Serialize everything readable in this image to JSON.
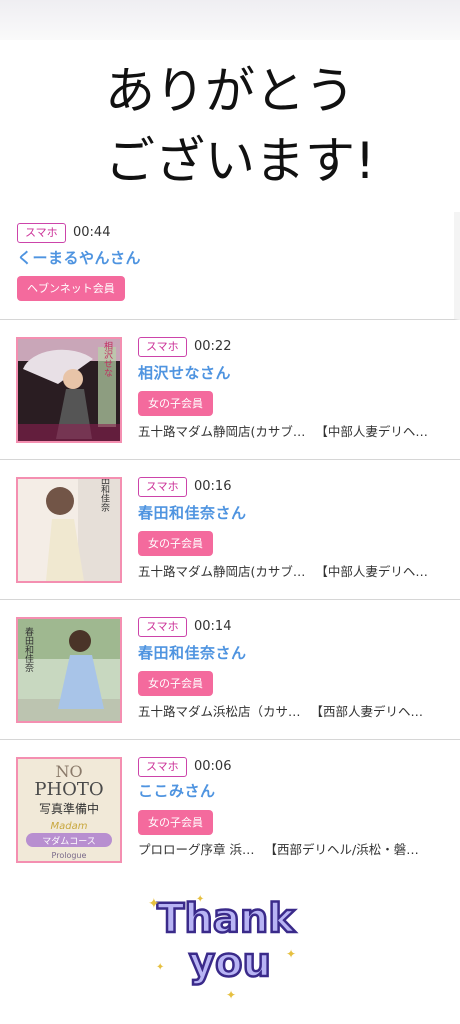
{
  "top_banner": {
    "text_line1": "ありがとう",
    "text_line2": "ございます!"
  },
  "entries": [
    {
      "device": "スマホ",
      "time": "00:44",
      "name": "くーまるやんさん",
      "member": "ヘブンネット会員",
      "shop": "",
      "area": ""
    },
    {
      "device": "スマホ",
      "time": "00:22",
      "name": "相沢せなさん",
      "member": "女の子会員",
      "shop": "五十路マダム静岡店(カサブ…",
      "area": "【中部人妻デリヘ…"
    },
    {
      "device": "スマホ",
      "time": "00:16",
      "name": "春田和佳奈さん",
      "member": "女の子会員",
      "shop": "五十路マダム静岡店(カサブ…",
      "area": "【中部人妻デリヘ…"
    },
    {
      "device": "スマホ",
      "time": "00:14",
      "name": "春田和佳奈さん",
      "member": "女の子会員",
      "shop": "五十路マダム浜松店（カサ…",
      "area": "【西部人妻デリヘ…"
    },
    {
      "device": "スマホ",
      "time": "00:06",
      "name": "ここみさん",
      "member": "女の子会員",
      "shop": "プロローグ序章 浜…",
      "area": "【西部デリヘル/浜松・磐…"
    }
  ],
  "thumbs": {
    "t2_text": "相沢せな",
    "t3_text": "春田和佳奈",
    "t4_text": "春田和佳奈",
    "t5_line1": "NO",
    "t5_line2": "PHOTO",
    "t5_line3": "写真準備中",
    "t5_line4": "Madam",
    "t5_line5": "マダムコース",
    "t5_line6": "Prologue"
  },
  "bottom_banner": {
    "line1": "Thank",
    "line2": "you"
  },
  "colors": {
    "accent_blue": "#4f94e0",
    "badge_pink": "#f46a9d",
    "device_border": "#cc44aa"
  }
}
